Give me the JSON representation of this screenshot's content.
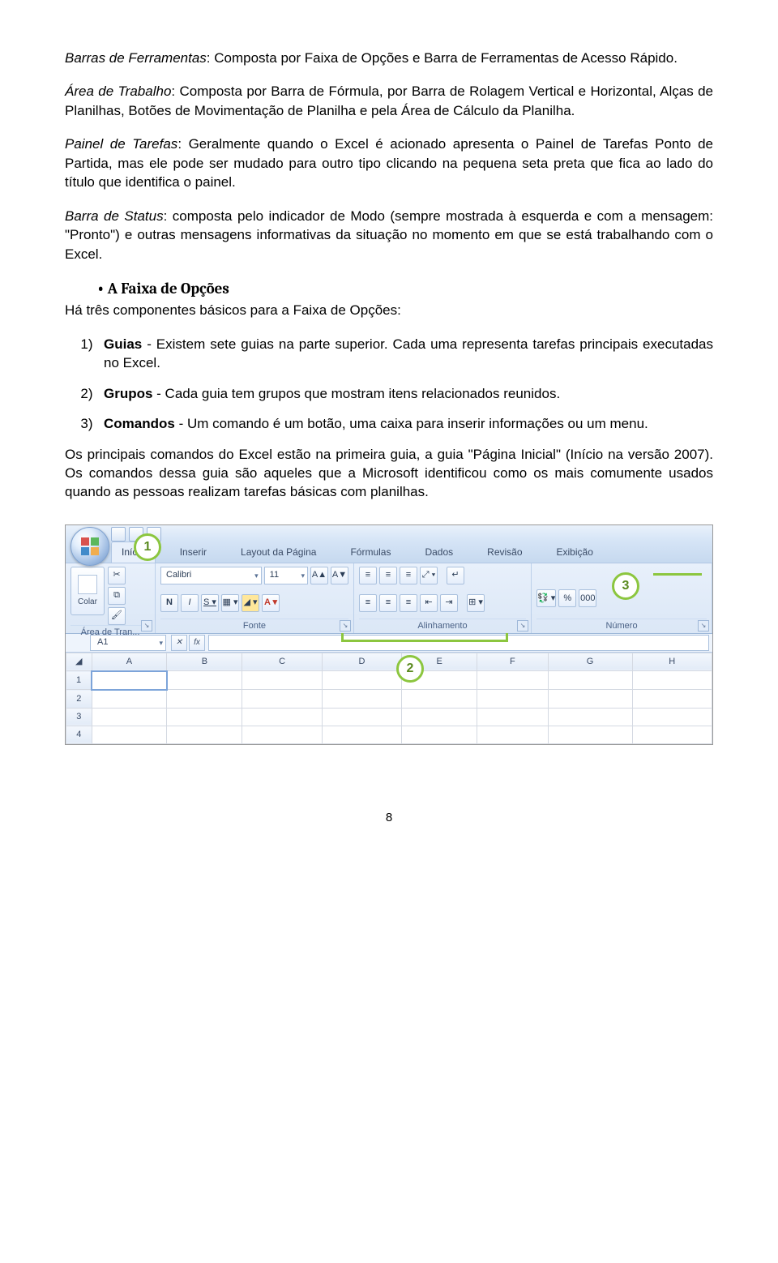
{
  "p1": {
    "term": "Barras de Ferramentas",
    "text": ": Composta por Faixa de Opções e Barra de Ferramentas de Acesso Rápido."
  },
  "p2": {
    "term": "Área de Trabalho",
    "text": ": Composta por Barra de Fórmula, por Barra de Rolagem Vertical e Horizontal, Alças de Planilhas, Botões de Movimentação de Planilha e pela Área de Cálculo da Planilha."
  },
  "p3": {
    "term": "Painel de Tarefas",
    "text": ": Geralmente quando o Excel é acionado apresenta o Painel de Tarefas Ponto de Partida, mas ele pode ser mudado para outro tipo clicando na pequena seta preta que fica ao lado do título que identifica o painel."
  },
  "p4": {
    "term": "Barra de Status",
    "text": ": composta pelo indicador de Modo (sempre mostrada à esquerda e com a mensagem: \"Pronto\") e outras mensagens informativas da situação no momento em que se está trabalhando com o Excel."
  },
  "h_section": "A Faixa de Opções",
  "p5": "Há três componentes básicos para a Faixa de Opções:",
  "li1": {
    "bold": "Guias",
    "rest": " - Existem sete guias na parte superior. Cada uma representa tarefas principais executadas no Excel."
  },
  "li2": {
    "bold": "Grupos",
    "rest": " - Cada guia tem grupos que mostram itens relacionados reunidos."
  },
  "li3": {
    "bold": "Comandos",
    "rest": " - Um comando é um botão, uma caixa para inserir informações ou um menu."
  },
  "p6": "Os principais comandos do Excel estão na primeira guia, a guia \"Página Inicial\" (Início na versão 2007). Os comandos dessa guia são aqueles que a Microsoft identificou como os mais comumente usados quando as pessoas realizam tarefas básicas com planilhas.",
  "page_number": "8",
  "ribbon": {
    "tabs": [
      "Início",
      "Inserir",
      "Layout da Página",
      "Fórmulas",
      "Dados",
      "Revisão",
      "Exibição"
    ],
    "active_tab": 0,
    "clipboard": {
      "paste": "Colar",
      "title": "Área de Tran..."
    },
    "font": {
      "name": "Calibri",
      "size": "11",
      "title": "Fonte"
    },
    "alignment": {
      "title": "Alinhamento"
    },
    "number": {
      "percent": "%",
      "thousands": "000",
      "title": "Número"
    },
    "callouts": {
      "c1": "1",
      "c2": "2",
      "c3": "3"
    },
    "namebox": "A1",
    "fx": "fx",
    "cols": [
      "A",
      "B",
      "C",
      "D",
      "E",
      "F",
      "G",
      "H"
    ],
    "rows": [
      "1",
      "2",
      "3",
      "4"
    ]
  }
}
